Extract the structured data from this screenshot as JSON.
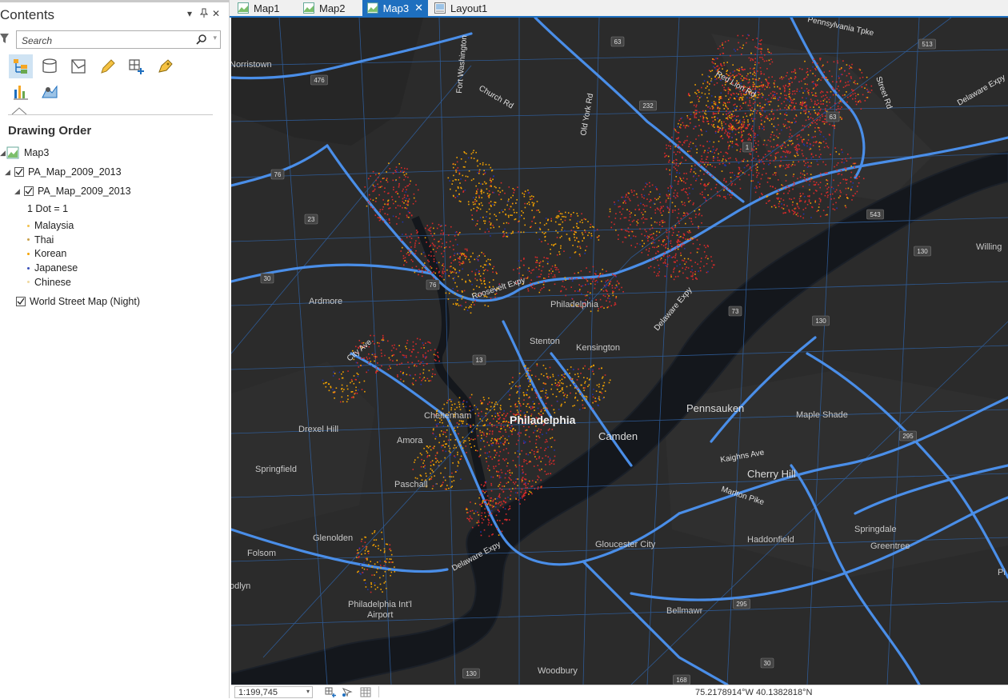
{
  "contents": {
    "title": "Contents",
    "menu_glyph": "▾",
    "pin_glyph": "ꟷ",
    "close_glyph": "✕",
    "search_placeholder": "Search",
    "drawing_order": "Drawing Order",
    "tools": [
      "list-by-drawing-order-icon",
      "list-by-source-icon",
      "list-by-selection-icon",
      "list-by-editing-icon",
      "list-by-snapping-icon",
      "list-by-labeling-icon",
      "list-by-charts-icon",
      "list-by-perspective-icon"
    ],
    "tree": {
      "map": "Map3",
      "group_layer": "PA_Map_2009_2013",
      "layer": "PA_Map_2009_2013",
      "dot_label": "1 Dot = 1",
      "legend": [
        {
          "label": "Malaysia",
          "color": "#f2c14e"
        },
        {
          "label": "Thai",
          "color": "#c8a04a"
        },
        {
          "label": "Korean",
          "color": "#f5a300"
        },
        {
          "label": "Japanese",
          "color": "#3a4fb8"
        },
        {
          "label": "Chinese",
          "color": "#f0d9a0"
        }
      ],
      "basemap": "World Street Map (Night)"
    }
  },
  "tabs": [
    {
      "label": "Map1",
      "active": false
    },
    {
      "label": "Map2",
      "active": false
    },
    {
      "label": "Map3",
      "active": true
    },
    {
      "label": "Layout1",
      "active": false
    }
  ],
  "map": {
    "places": [
      "Norristown",
      "Ardmore",
      "Drexel Hill",
      "Springfield",
      "Glenolden",
      "Folsom",
      "odlyn",
      "Philadelphia Int'l",
      "Airport",
      "Stenton",
      "Kensington",
      "Philadelphia",
      "Camden",
      "Pennsauken",
      "Maple Shade",
      "Cherry Hill",
      "Haddonfield",
      "Springdale",
      "Greentree",
      "Gloucester City",
      "Bellmawr",
      "Woodbury",
      "Willing",
      "Pi",
      "Paschall",
      "Amora",
      "Cheltenham",
      "Philadelphia"
    ],
    "roads": [
      "Church Rd",
      "Old York Rd",
      "Fort Washington",
      "Roosevelt Expy",
      "Delaware Expy",
      "Delaware Expy",
      "Kaighns Ave",
      "Marlton Pike",
      "Red Lion Rd",
      "Street Rd",
      "Pennsylvania Tpke",
      "Delaware Expy",
      "City Ave"
    ],
    "shields": [
      "476",
      "76",
      "23",
      "30",
      "76",
      "63",
      "232",
      "63",
      "1",
      "543",
      "130",
      "73",
      "130",
      "13",
      "295",
      "295",
      "30",
      "168",
      "130",
      "513"
    ],
    "colors": {
      "background": "#2a2a2a",
      "road": "#3f7fd6",
      "highway": "#4a8ee8",
      "water": "#0f1217",
      "dots_red": "#d82a2a",
      "dots_orange": "#f5a300",
      "dots_blue": "#2233aa"
    }
  },
  "status": {
    "scale": "1:199,745",
    "coords": "75.2178914°W 40.1382818°N"
  }
}
